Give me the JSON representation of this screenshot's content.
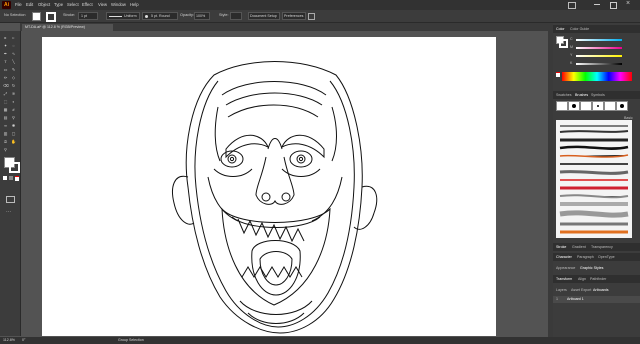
{
  "app": {
    "logo": "Ai"
  },
  "menubar": {
    "items": [
      "File",
      "Edit",
      "Object",
      "Type",
      "Select",
      "Effect",
      "View",
      "Window",
      "Help"
    ]
  },
  "control_bar": {
    "selection": "No Selection",
    "stroke_label": "Stroke:",
    "stroke_value": "1 pt",
    "uniform_label": "Uniform",
    "brush_label": "5 pt. Round",
    "opacity_label": "Opacity:",
    "opacity_value": "100%",
    "style_label": "Style:",
    "doc_setup": "Document Setup",
    "preferences": "Preferences"
  },
  "document_tab": {
    "title": "MT-DA.ai* @ 112.8 % (RGB/Preview)"
  },
  "color_panel": {
    "tabs": [
      "Color",
      "Color Guide"
    ],
    "channels": [
      "C",
      "M",
      "Y",
      "K"
    ]
  },
  "brushes_panel": {
    "tabs": [
      "Swatches",
      "Brushes",
      "Symbols"
    ],
    "basic_label": "Basic"
  },
  "panel_tabs": {
    "stroke": [
      "Stroke",
      "Gradient",
      "Transparency"
    ],
    "character": [
      "Character",
      "Paragraph",
      "OpenType"
    ],
    "appearance": [
      "Appearance",
      "Graphic Styles"
    ],
    "transform": [
      "Transform",
      "Align",
      "Pathfinder"
    ],
    "layers": [
      "Layers",
      "Asset Export",
      "Artboards"
    ]
  },
  "artboards": {
    "rows": [
      {
        "index": "1",
        "name": "Artboard 1"
      }
    ]
  },
  "status": {
    "zoom": "112.8%",
    "angle": "0°",
    "tool": "Group Selection"
  },
  "colors": {
    "accent": "#2d8ceb",
    "app_orange": "#ff9a00"
  }
}
